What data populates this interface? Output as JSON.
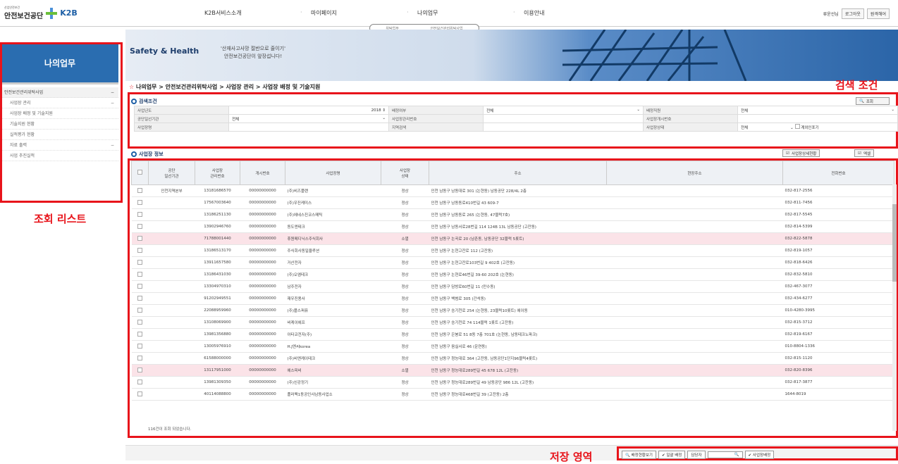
{
  "header": {
    "logo_small": "산업안전보건",
    "logo_org": "안전보건공단",
    "logo_brand": "K2B",
    "nav": [
      "K2B서비스소개",
      "마이페이지",
      "나의업무",
      "이용안내"
    ],
    "user": "류윤선님",
    "logout": "로그아웃",
    "home": "원격해어",
    "subtabs": [
      "위탁업무",
      "안전보건관리위탁사업"
    ]
  },
  "sidebar": {
    "title": "나의업무",
    "items": [
      {
        "label": "안전보건관리위탁사업",
        "sub": false,
        "toggle": "−"
      },
      {
        "label": "사업장 관리",
        "sub": true,
        "toggle": "−"
      },
      {
        "label": "사업장 배정 및 기술지원",
        "sub": true,
        "toggle": ""
      },
      {
        "label": "기술지원 현황",
        "sub": true,
        "toggle": ""
      },
      {
        "label": "실적평가 현황",
        "sub": true,
        "toggle": ""
      },
      {
        "label": "자료 출력",
        "sub": true,
        "toggle": "−"
      },
      {
        "label": "사업 추진실적",
        "sub": true,
        "toggle": ""
      }
    ]
  },
  "labels": {
    "list": "조회 리스트",
    "search": "검색 조건",
    "save": "저장 영역"
  },
  "banner": {
    "title": "Safety & Health",
    "quote1": "'산재사고사망 절반으로 줄이기'",
    "quote2": "안전보건공단이 앞장섭니다!"
  },
  "breadcrumb": "나의업무 > 안전보건관리위탁사업 > 사업장 관리 > 사업장 배정 및 기술지원",
  "search": {
    "title": "검색조건",
    "button": "조회",
    "rows": [
      [
        {
          "label": "사업년도",
          "value": "2018"
        },
        {
          "label": "배정여부",
          "value": "전체"
        },
        {
          "label": "배정직원",
          "value": "전체"
        }
      ],
      [
        {
          "label": "공단일선기관",
          "value": "전체"
        },
        {
          "label": "사업장관리번호",
          "value": ""
        },
        {
          "label": "사업장개시번호",
          "value": ""
        }
      ],
      [
        {
          "label": "사업장명",
          "value": ""
        },
        {
          "label": "지역검색",
          "value": ""
        },
        {
          "label": "사업장상태",
          "value": "전체"
        }
      ]
    ],
    "extra_checkbox": "계외인포기"
  },
  "list": {
    "title": "사업장 정보",
    "btn_status": "사업장상세현황",
    "btn_excel": "엑셀",
    "columns": [
      "",
      "공단\n일선기관",
      "사업장\n관리번호",
      "개시번호",
      "사업장명",
      "사업장\n상태",
      "주소",
      "현장주소",
      "전화번호"
    ],
    "rows": [
      {
        "org": "인천지역본부",
        "no": "13181686570",
        "open": "00000000000",
        "name": "(주)비즈플랜",
        "state": "정상",
        "addr": "인천 남동구 남동대로 301 (논현동) 남동공단 228/4L 2층",
        "tel": "032-817-2556",
        "pink": false
      },
      {
        "org": "",
        "no": "17567003640",
        "open": "00000000000",
        "name": "(주)우진케미스",
        "state": "정상",
        "addr": "인천 남동구 남동동로410번길 43 609-7",
        "tel": "032-811-7456",
        "pink": false
      },
      {
        "org": "",
        "no": "13186251130",
        "open": "00000000000",
        "name": "(주)에네스진코스메틱",
        "state": "정상",
        "addr": "인천 남동구 남동동로 265 (논현동, 47블럭7호)",
        "tel": "032-817-5545",
        "pink": false
      },
      {
        "org": "",
        "no": "13902946760",
        "open": "00000000000",
        "name": "동도엔테크",
        "state": "정상",
        "addr": "인천 남동구 남동서로28번길 114 124B 13L 남동공단 (고잔동)",
        "tel": "032-814-5399",
        "pink": false
      },
      {
        "org": "",
        "no": "71788001440",
        "open": "00000000000",
        "name": "휴원메디닉스주식회사",
        "state": "소멸",
        "addr": "인천 남동구 논곡로 20 (남촌동, 남동공단 32블럭 5롯트)",
        "tel": "032-822-5878",
        "pink": true
      },
      {
        "org": "",
        "no": "13186513170",
        "open": "00000000000",
        "name": "주식회사동일율루션",
        "state": "정상",
        "addr": "인천 남동구 논현고잔로 112 (고잔동)",
        "tel": "032-819-1057",
        "pink": false
      },
      {
        "org": "",
        "no": "13911657580",
        "open": "00000000000",
        "name": "거산전자",
        "state": "정상",
        "addr": "인천 남동구 논현고잔로103번길 9 402호 (고잔동)",
        "tel": "032-818-6426",
        "pink": false
      },
      {
        "org": "",
        "no": "13186431030",
        "open": "00000000000",
        "name": "(주)오엠테크",
        "state": "정상",
        "addr": "인천 남동구 논현로46번길 39-60 202호 (논현동)",
        "tel": "032-832-5810",
        "pink": false
      },
      {
        "org": "",
        "no": "13304970310",
        "open": "00000000000",
        "name": "남주전자",
        "state": "정상",
        "addr": "인천 남동구 담방로60번길 11 (만수동)",
        "tel": "032-467-3077",
        "pink": false
      },
      {
        "org": "",
        "no": "91202949551",
        "open": "00000000000",
        "name": "재우진용사",
        "state": "정상",
        "addr": "인천 남동구 백범로 305 (간석동)",
        "tel": "032-434-6277",
        "pink": false
      },
      {
        "org": "",
        "no": "22088959960",
        "open": "00000000000",
        "name": "(주)플스퍼퓨",
        "state": "정상",
        "addr": "인천 남동구 승기천로 254 (논현동, 23블럭10롯트) 에이동",
        "tel": "010-4280-3995",
        "pink": false
      },
      {
        "org": "",
        "no": "13108069900",
        "open": "00000000000",
        "name": "비케이에프",
        "state": "정상",
        "addr": "인천 남동구 승기천로 74 114블럭 1롯트 (고잔동)",
        "tel": "032-815-3712",
        "pink": false
      },
      {
        "org": "",
        "no": "13981356880",
        "open": "00000000000",
        "name": "아타코전자(주)",
        "state": "정상",
        "addr": "인천 남동구 은봉로 51 8동 7층 701호 (논현동, 남동테크노파크)",
        "tel": "032-819-6167",
        "pink": false
      },
      {
        "org": "",
        "no": "13005976910",
        "open": "00000000000",
        "name": "H.J엔씨korea",
        "state": "정상",
        "addr": "인천 남동구 음실서로 46 (운연동)",
        "tel": "010-8804-1336",
        "pink": false
      },
      {
        "org": "",
        "no": "61588000000",
        "open": "00000000000",
        "name": "(주)비엔케이테크",
        "state": "정상",
        "addr": "인천 남동구 청능대로 364 (고잔동, 남동공단1단지96블럭4롯트)",
        "tel": "032-815-1120",
        "pink": false
      },
      {
        "org": "",
        "no": "13117951000",
        "open": "00000000000",
        "name": "에스피비",
        "state": "소멸",
        "addr": "인천 남동구 청능대로289번길 45 678 12L (고잔동)",
        "tel": "032-820-8396",
        "pink": true
      },
      {
        "org": "",
        "no": "13981309350",
        "open": "00000000000",
        "name": "(주)신강정기",
        "state": "정상",
        "addr": "인천 남동구 청능대로289번길 49 남동공단 986 12L (고잔동)",
        "tel": "032-817-3877",
        "pink": false
      },
      {
        "org": "",
        "no": "40114088800",
        "open": "00000000000",
        "name": "플러팩1동공인사남동사업소",
        "state": "정상",
        "addr": "인천 남동구 청능대로468번길 39 (고잔동) 2층",
        "tel": "1644-8019",
        "pink": false
      }
    ],
    "footer": "116건이 조회 되었습니다."
  },
  "bottom": {
    "btn1": "배정현황보기",
    "btn2": "일괄 배정",
    "assignee_label": "담당자",
    "btn3": "사업장배정"
  },
  "colors": {
    "accent": "#2a6db0",
    "annotation": "#e8141b",
    "pink_row": "#fbe3e8"
  }
}
